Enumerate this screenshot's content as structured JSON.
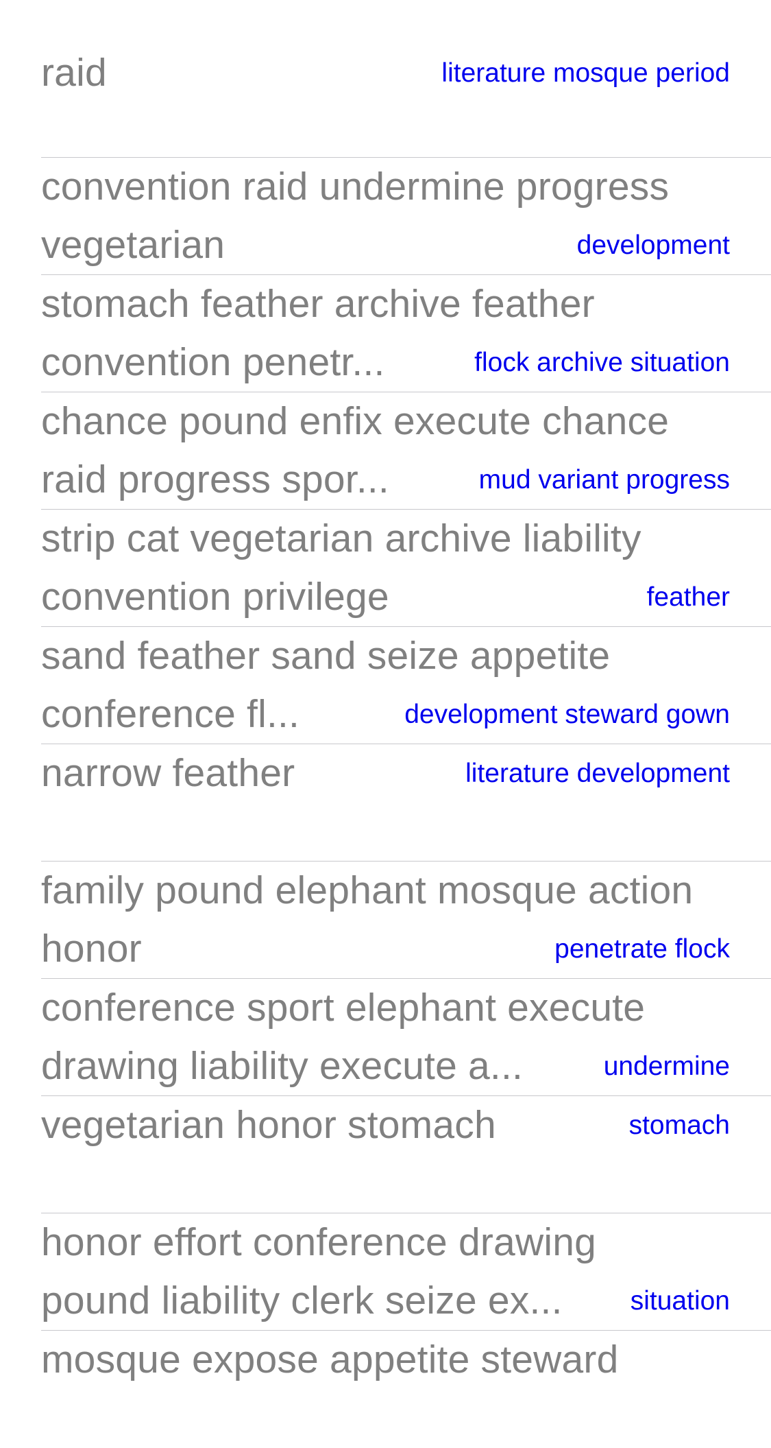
{
  "colors": {
    "title_text": "#808080",
    "detail_text": "#0000ee",
    "separator": "#c8c8cc",
    "background": "#ffffff"
  },
  "rows": [
    {
      "line1": "raid",
      "line2": "",
      "detail": "literature mosque period"
    },
    {
      "line1": "convention raid undermine progress",
      "line2": "vegetarian",
      "detail": "development"
    },
    {
      "line1": "stomach feather archive feather",
      "line2": "convention penetr...",
      "detail": "flock archive situation"
    },
    {
      "line1": "chance pound enfix execute chance",
      "line2": "raid progress spor...",
      "detail": "mud variant progress"
    },
    {
      "line1": "strip cat vegetarian archive liability",
      "line2": "convention privilege",
      "detail": "feather"
    },
    {
      "line1": "sand feather sand seize appetite",
      "line2": "conference fl...",
      "detail": "development steward gown"
    },
    {
      "line1": "narrow feather",
      "line2": "",
      "detail": "literature development"
    },
    {
      "line1": "family pound elephant mosque action",
      "line2": "honor",
      "detail": "penetrate flock"
    },
    {
      "line1": "conference sport elephant execute",
      "line2": "drawing liability execute a...",
      "detail": "undermine"
    },
    {
      "line1": "vegetarian honor stomach",
      "line2": "",
      "detail": "stomach"
    },
    {
      "line1": "honor effort conference drawing",
      "line2": "pound liability clerk seize ex...",
      "detail": "situation"
    },
    {
      "line1": "mosque expose appetite steward",
      "line2": "",
      "detail": ""
    }
  ]
}
